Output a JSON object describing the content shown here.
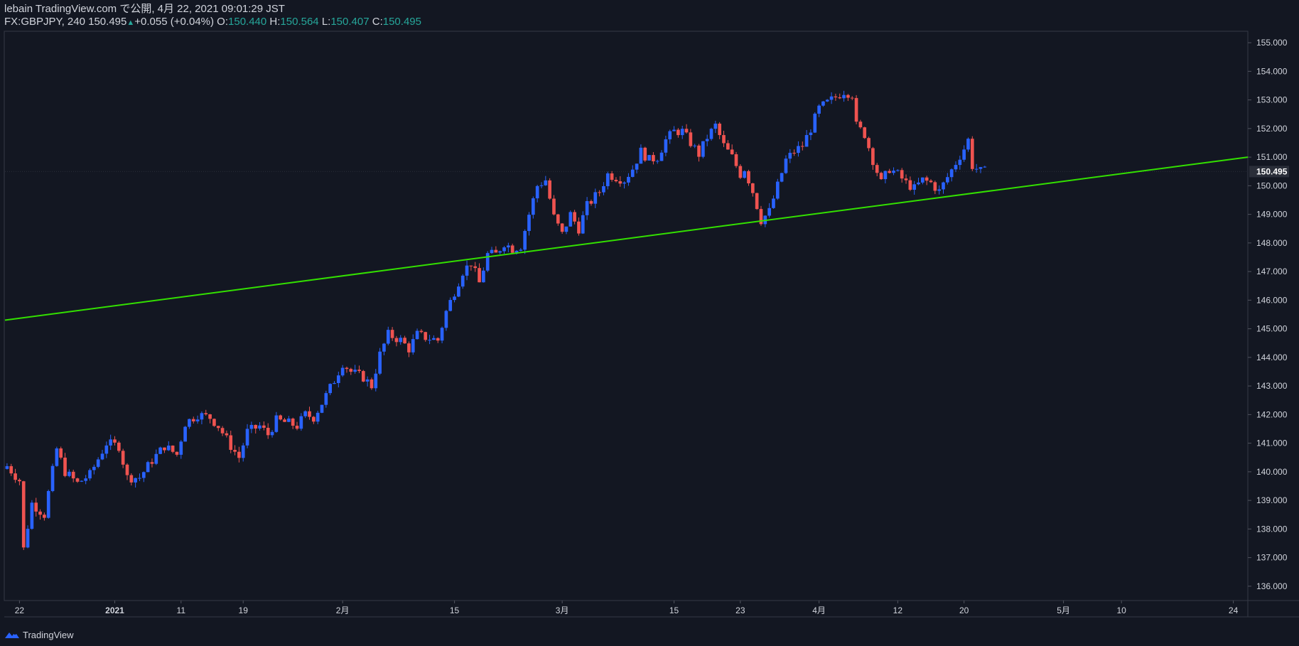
{
  "header": {
    "publish_line": "lebain TradingView.com で公開, 4月 22, 2021 09:01:29 JST",
    "symbol": "FX:GBPJPY, 240",
    "last_price": "150.495",
    "change": "+0.055 (+0.04%)",
    "open_label": "O:",
    "open_value": "150.440",
    "high_label": "H:",
    "high_value": "150.564",
    "low_label": "L:",
    "low_value": "150.407",
    "close_label": "C:",
    "close_value": "150.495"
  },
  "footer": {
    "brand": "TradingView",
    "logo_icon": "tradingview-logo-icon"
  },
  "colors": {
    "background": "#131722",
    "up": "#2962ff",
    "down": "#ef5350",
    "trendline": "#33e000",
    "teal": "#26a69a",
    "text": "#d1d4dc"
  },
  "chart_data": {
    "type": "candlestick",
    "symbol": "FX:GBPJPY",
    "interval": "240",
    "ylim": [
      135.5,
      155.4
    ],
    "y_ticks": [
      "136.000",
      "137.000",
      "138.000",
      "139.000",
      "140.000",
      "141.000",
      "142.000",
      "143.000",
      "144.000",
      "145.000",
      "146.000",
      "147.000",
      "148.000",
      "149.000",
      "150.000",
      "151.000",
      "152.000",
      "153.000",
      "154.000",
      "155.000"
    ],
    "current_price_label": "150.495",
    "current_price": 150.495,
    "x_ticks": [
      {
        "label": "22",
        "bar": 3
      },
      {
        "label": "2021",
        "bar": 26,
        "bold": true
      },
      {
        "label": "11",
        "bar": 42
      },
      {
        "label": "19",
        "bar": 57
      },
      {
        "label": "2月",
        "bar": 81
      },
      {
        "label": "15",
        "bar": 108
      },
      {
        "label": "3月",
        "bar": 134
      },
      {
        "label": "15",
        "bar": 161
      },
      {
        "label": "23",
        "bar": 177
      },
      {
        "label": "4月",
        "bar": 196
      },
      {
        "label": "12",
        "bar": 215
      },
      {
        "label": "20",
        "bar": 231
      },
      {
        "label": "5月",
        "bar": 255
      },
      {
        "label": "10",
        "bar": 269
      },
      {
        "label": "24",
        "bar": 296
      }
    ],
    "bars_total": 300,
    "close_path": [
      [
        0,
        140.2
      ],
      [
        3,
        139.7
      ],
      [
        4,
        137.3
      ],
      [
        6,
        138.9
      ],
      [
        9,
        138.5
      ],
      [
        12,
        140.8
      ],
      [
        14,
        140.0
      ],
      [
        17,
        139.6
      ],
      [
        20,
        139.9
      ],
      [
        24,
        141.0
      ],
      [
        27,
        140.9
      ],
      [
        29,
        139.8
      ],
      [
        32,
        139.8
      ],
      [
        35,
        140.4
      ],
      [
        38,
        140.9
      ],
      [
        41,
        140.6
      ],
      [
        43,
        141.7
      ],
      [
        46,
        142.0
      ],
      [
        49,
        141.9
      ],
      [
        51,
        141.6
      ],
      [
        54,
        140.9
      ],
      [
        56,
        140.5
      ],
      [
        58,
        141.4
      ],
      [
        61,
        141.6
      ],
      [
        63,
        141.3
      ],
      [
        65,
        141.8
      ],
      [
        68,
        141.7
      ],
      [
        70,
        141.6
      ],
      [
        72,
        142.0
      ],
      [
        74,
        141.9
      ],
      [
        76,
        142.4
      ],
      [
        79,
        143.2
      ],
      [
        81,
        143.8
      ],
      [
        83,
        143.5
      ],
      [
        86,
        143.3
      ],
      [
        88,
        143.0
      ],
      [
        90,
        144.1
      ],
      [
        92,
        144.8
      ],
      [
        95,
        144.6
      ],
      [
        97,
        144.3
      ],
      [
        99,
        144.8
      ],
      [
        101,
        144.7
      ],
      [
        104,
        144.6
      ],
      [
        106,
        145.6
      ],
      [
        108,
        146.3
      ],
      [
        110,
        147.0
      ],
      [
        112,
        147.3
      ],
      [
        114,
        146.6
      ],
      [
        116,
        147.6
      ],
      [
        118,
        147.6
      ],
      [
        120,
        148.0
      ],
      [
        122,
        147.8
      ],
      [
        124,
        147.9
      ],
      [
        126,
        149.0
      ],
      [
        128,
        150.0
      ],
      [
        130,
        150.2
      ],
      [
        132,
        148.9
      ],
      [
        134,
        148.3
      ],
      [
        136,
        149.0
      ],
      [
        138,
        148.5
      ],
      [
        140,
        149.3
      ],
      [
        143,
        149.8
      ],
      [
        145,
        150.4
      ],
      [
        147,
        150.3
      ],
      [
        149,
        150.2
      ],
      [
        151,
        150.6
      ],
      [
        153,
        151.2
      ],
      [
        155,
        150.9
      ],
      [
        157,
        151.0
      ],
      [
        159,
        151.6
      ],
      [
        161,
        151.9
      ],
      [
        163,
        151.9
      ],
      [
        165,
        151.5
      ],
      [
        167,
        151.1
      ],
      [
        169,
        151.7
      ],
      [
        171,
        152.1
      ],
      [
        173,
        151.4
      ],
      [
        175,
        151.0
      ],
      [
        177,
        150.4
      ],
      [
        178,
        150.6
      ],
      [
        180,
        149.8
      ],
      [
        182,
        148.8
      ],
      [
        184,
        149.1
      ],
      [
        186,
        150.0
      ],
      [
        188,
        150.9
      ],
      [
        190,
        151.2
      ],
      [
        192,
        151.4
      ],
      [
        194,
        152.0
      ],
      [
        196,
        152.7
      ],
      [
        198,
        152.9
      ],
      [
        200,
        153.1
      ],
      [
        202,
        153.3
      ],
      [
        204,
        153.2
      ],
      [
        205,
        152.1
      ],
      [
        207,
        151.8
      ],
      [
        209,
        150.9
      ],
      [
        211,
        150.1
      ],
      [
        213,
        150.6
      ],
      [
        215,
        150.4
      ],
      [
        217,
        150.1
      ],
      [
        219,
        149.9
      ],
      [
        221,
        150.2
      ],
      [
        223,
        150.1
      ],
      [
        225,
        149.8
      ],
      [
        227,
        150.3
      ],
      [
        229,
        150.8
      ],
      [
        231,
        151.3
      ],
      [
        232,
        151.6
      ],
      [
        233,
        150.7
      ],
      [
        235,
        150.5
      ],
      [
        236,
        150.5
      ]
    ],
    "trendline": {
      "start": [
        0,
        145.3
      ],
      "end": [
        300,
        151.0
      ]
    }
  }
}
